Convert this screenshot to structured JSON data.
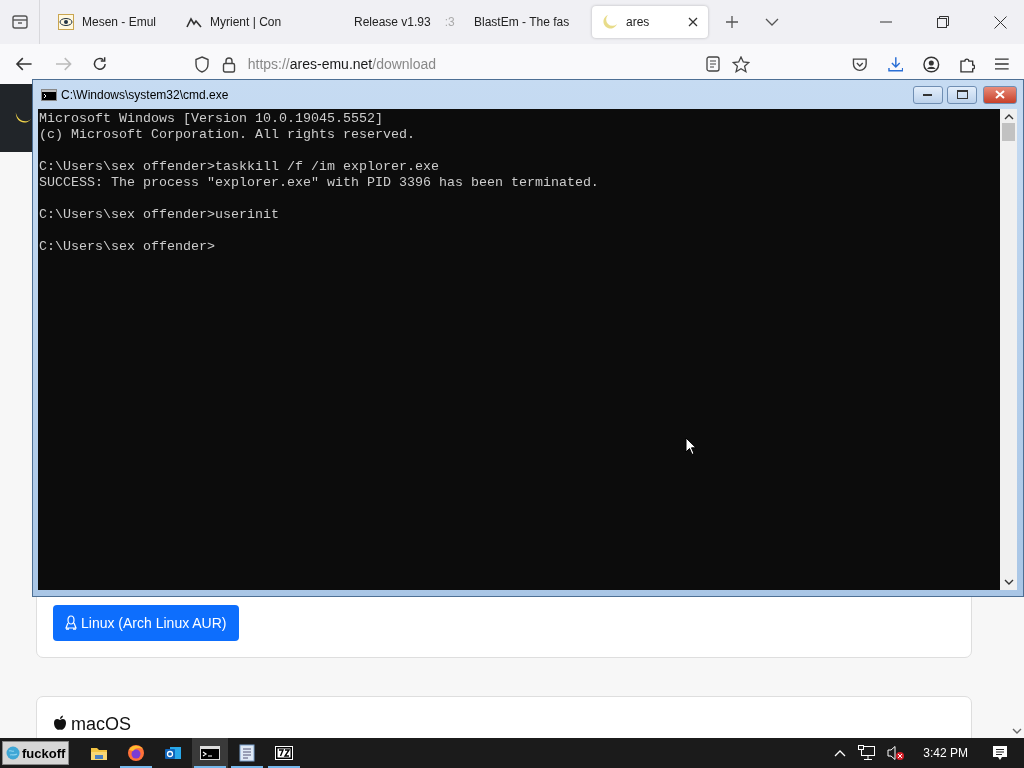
{
  "browser": {
    "tabs": [
      {
        "title": "Mesen - Emul",
        "kind": "eye",
        "selected": false
      },
      {
        "title": "Myrient | Con",
        "kind": "myrient",
        "selected": false
      },
      {
        "title": "Release v1.93",
        "title_tail": ":3",
        "kind": "github",
        "selected": false
      },
      {
        "title": "BlastEm - The fas",
        "selected": false
      },
      {
        "title": "ares",
        "kind": "moon",
        "selected": true
      }
    ],
    "url_scheme": "https://",
    "url_host": "ares-emu.net",
    "url_path": "/download"
  },
  "page": {
    "linux_button": "Linux (Arch Linux AUR)",
    "macos_heading": "macOS"
  },
  "console": {
    "title": "C:\\Windows\\system32\\cmd.exe",
    "blocks": [
      [
        "Microsoft Windows [Version 10.0.19045.5552]",
        "(c) Microsoft Corporation. All rights reserved."
      ],
      [
        "C:\\Users\\sex offender>taskkill /f /im explorer.exe",
        "SUCCESS: The process \"explorer.exe\" with PID 3396 has been terminated."
      ],
      [
        "C:\\Users\\sex offender>userinit"
      ],
      [
        "C:\\Users\\sex offender>"
      ]
    ]
  },
  "taskbar": {
    "start_label": "fuckoff",
    "apps": [
      {
        "kind": "folder",
        "running": false,
        "selected": false
      },
      {
        "kind": "firefox",
        "running": true,
        "selected": false
      },
      {
        "kind": "mail",
        "running": false,
        "selected": false
      },
      {
        "kind": "console",
        "running": true,
        "selected": true
      },
      {
        "kind": "notepad",
        "running": true,
        "selected": false
      },
      {
        "kind": "archive",
        "running": true,
        "selected": false
      }
    ],
    "time": "3:42 PM",
    "volume_muted": true
  }
}
